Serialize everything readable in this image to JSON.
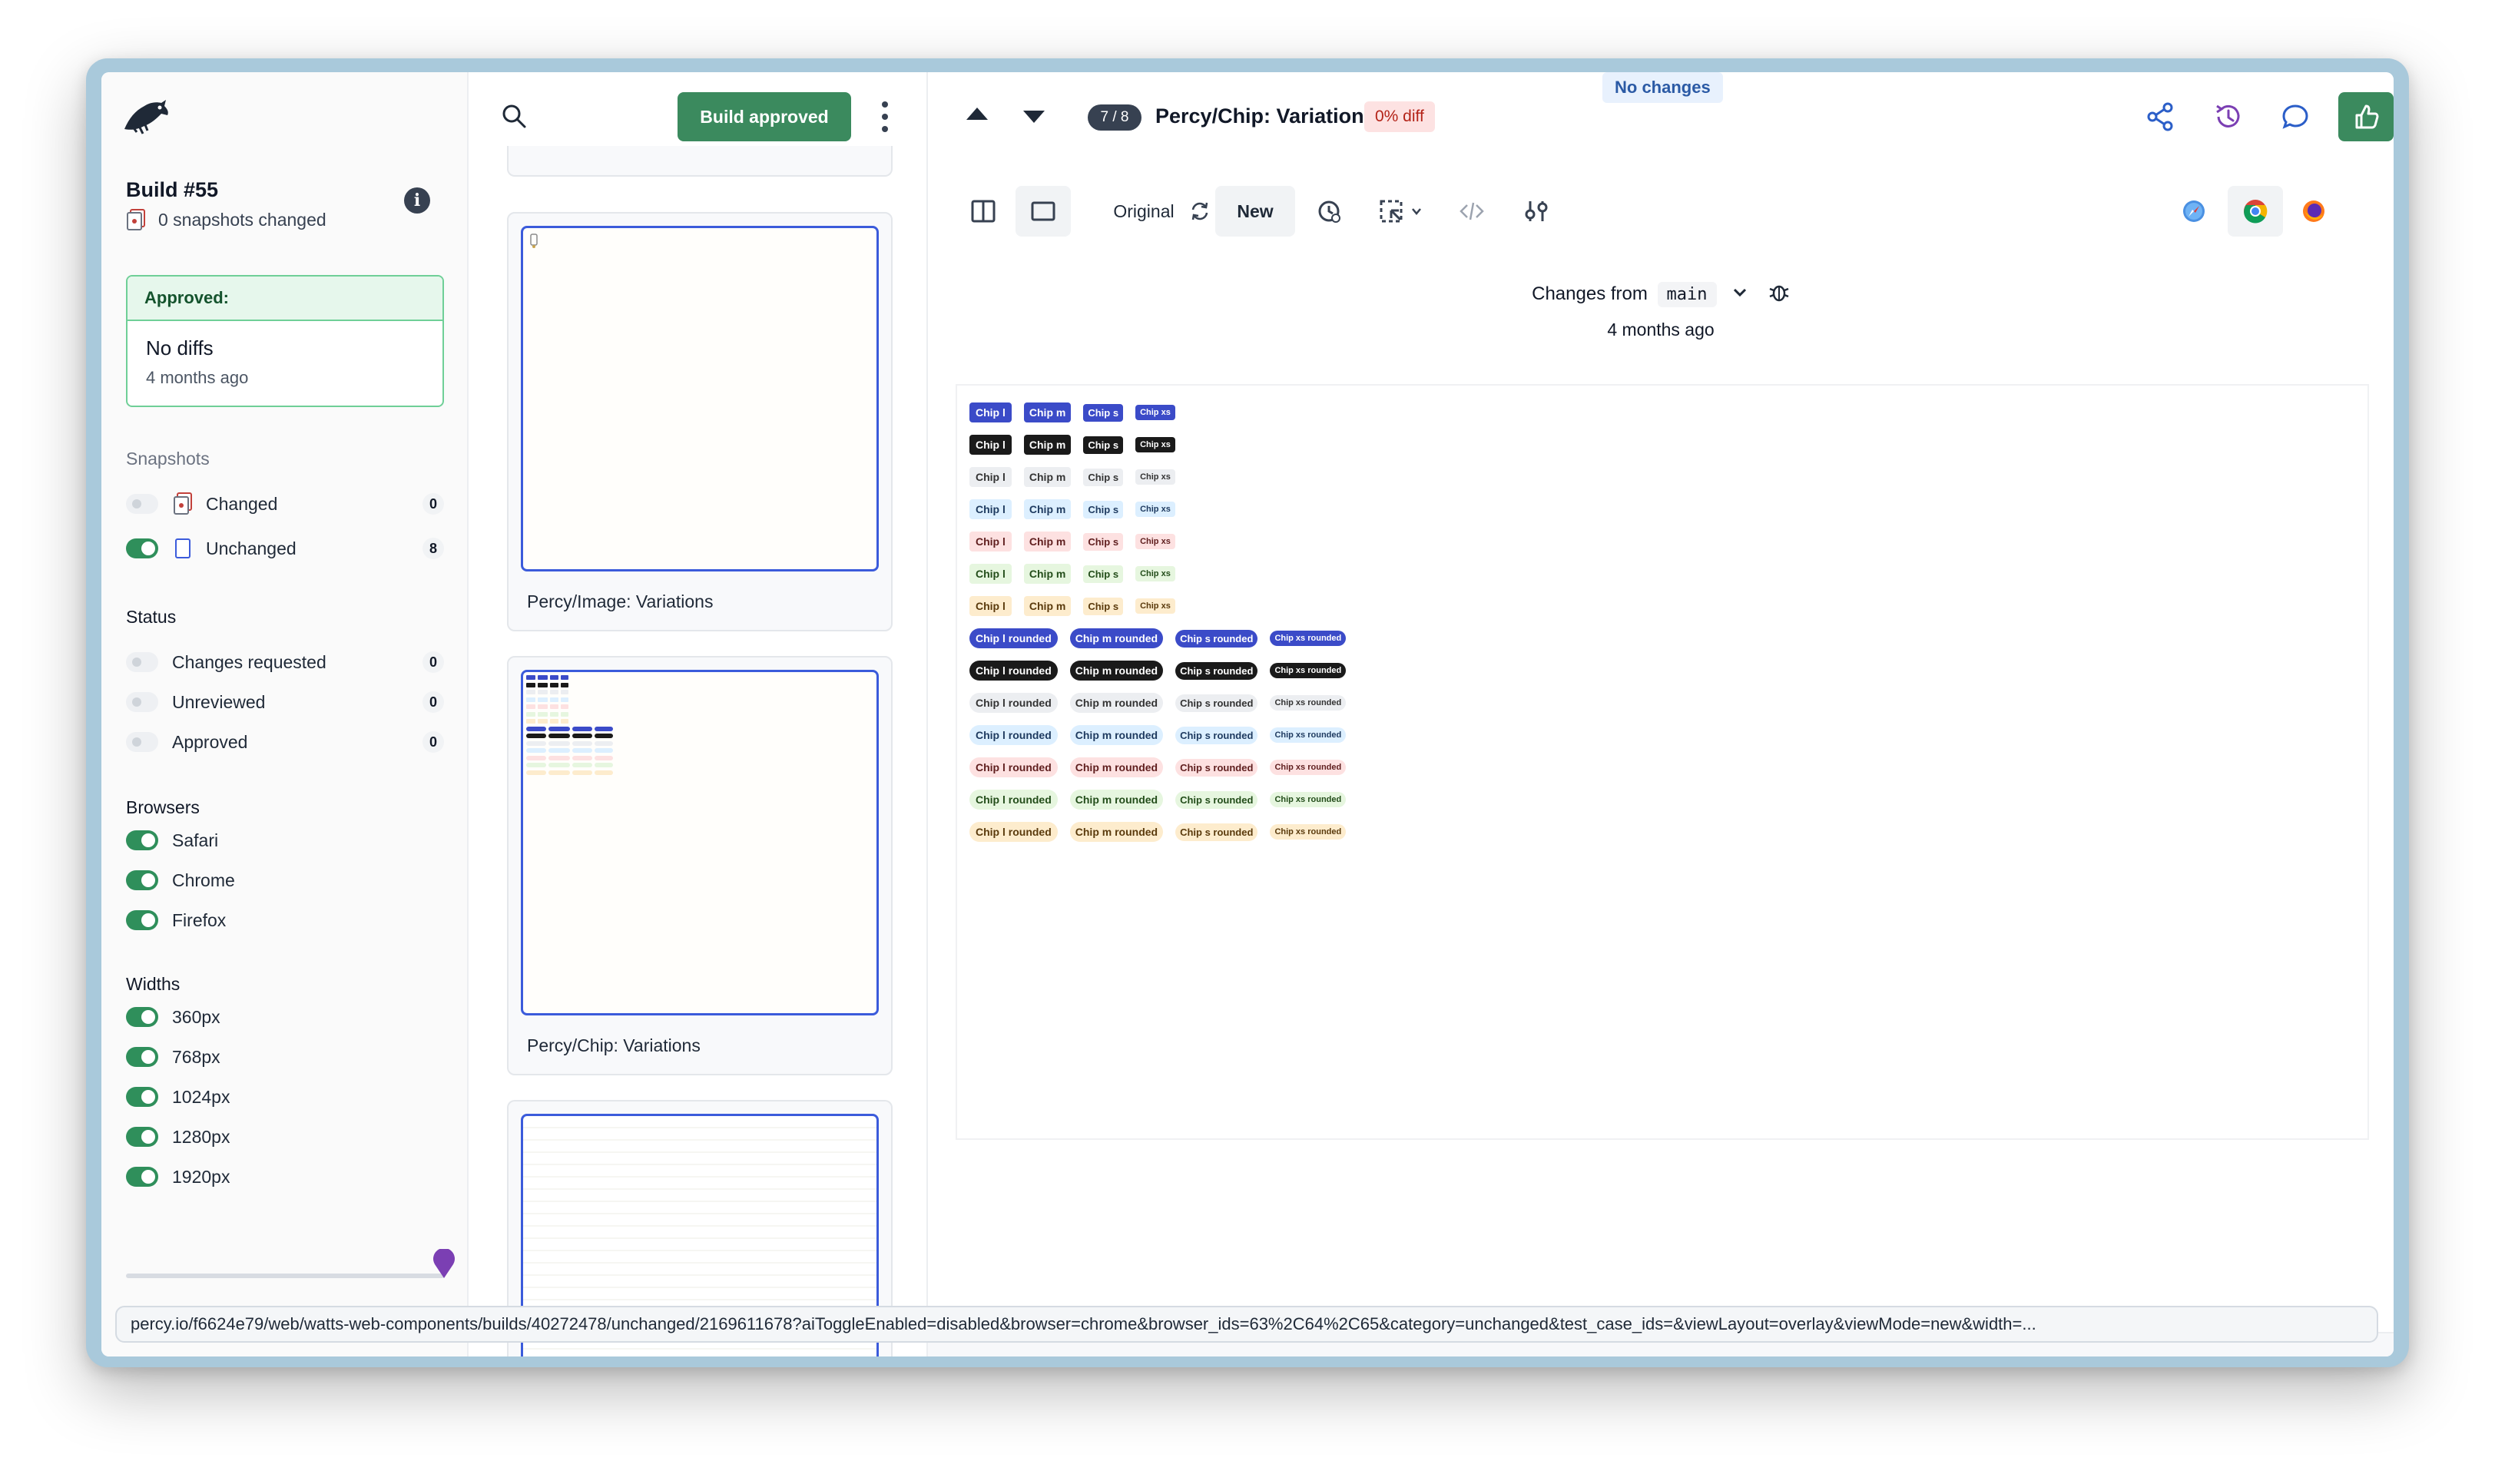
{
  "sidebar": {
    "build_title": "Build #55",
    "snapshots_changed": "0 snapshots changed",
    "approved_card": {
      "header": "Approved:",
      "status": "No diffs",
      "time": "4 months ago"
    },
    "snapshots_label": "Snapshots",
    "snapshot_filters": [
      {
        "label": "Changed",
        "count": "0",
        "enabled": false
      },
      {
        "label": "Unchanged",
        "count": "8",
        "enabled": true
      }
    ],
    "status_label": "Status",
    "status_filters": [
      {
        "label": "Changes requested",
        "count": "0"
      },
      {
        "label": "Unreviewed",
        "count": "0"
      },
      {
        "label": "Approved",
        "count": "0"
      }
    ],
    "browsers_label": "Browsers",
    "browsers": [
      {
        "label": "Safari",
        "enabled": true
      },
      {
        "label": "Chrome",
        "enabled": true
      },
      {
        "label": "Firefox",
        "enabled": true
      }
    ],
    "widths_label": "Widths",
    "widths": [
      {
        "label": "360px",
        "enabled": true
      },
      {
        "label": "768px",
        "enabled": true
      },
      {
        "label": "1024px",
        "enabled": true
      },
      {
        "label": "1280px",
        "enabled": true
      },
      {
        "label": "1920px",
        "enabled": true
      }
    ],
    "slider_value": 1.0
  },
  "list": {
    "build_approved_label": "Build approved",
    "cards": [
      {
        "label": "Percy/Image: Variations"
      },
      {
        "label": "Percy/Chip: Variations"
      }
    ]
  },
  "main": {
    "counter": "7 / 8",
    "snapshot_title": "Percy/Chip: Variations",
    "diff_badge": "0% diff",
    "no_changes_badge": "No changes",
    "toolbar": {
      "original_label": "Original",
      "new_label": "New"
    },
    "changes_from_label": "Changes from",
    "branch": "main",
    "changes_time": "4 months ago"
  },
  "chip_rows": [
    {
      "chips": [
        "Chip l",
        "Chip m",
        "Chip s",
        "Chip xs"
      ],
      "bg": "#3b4bc8",
      "fg": "#ffffff",
      "rounded": false
    },
    {
      "chips": [
        "Chip l",
        "Chip m",
        "Chip s",
        "Chip xs"
      ],
      "bg": "#1a1a1a",
      "fg": "#ffffff",
      "rounded": false
    },
    {
      "chips": [
        "Chip l",
        "Chip m",
        "Chip s",
        "Chip xs"
      ],
      "bg": "#eceef1",
      "fg": "#333333",
      "rounded": false
    },
    {
      "chips": [
        "Chip l",
        "Chip m",
        "Chip s",
        "Chip xs"
      ],
      "bg": "#dcefff",
      "fg": "#1e3a5f",
      "rounded": false
    },
    {
      "chips": [
        "Chip l",
        "Chip m",
        "Chip s",
        "Chip xs"
      ],
      "bg": "#fde1e1",
      "fg": "#5f1e1e",
      "rounded": false
    },
    {
      "chips": [
        "Chip l",
        "Chip m",
        "Chip s",
        "Chip xs"
      ],
      "bg": "#e6f6df",
      "fg": "#234d1a",
      "rounded": false
    },
    {
      "chips": [
        "Chip l",
        "Chip m",
        "Chip s",
        "Chip xs"
      ],
      "bg": "#fdeccd",
      "fg": "#5a3a0c",
      "rounded": false
    },
    {
      "chips": [
        "Chip l rounded",
        "Chip m rounded",
        "Chip s rounded",
        "Chip xs rounded"
      ],
      "bg": "#3b4bc8",
      "fg": "#ffffff",
      "rounded": true
    },
    {
      "chips": [
        "Chip l rounded",
        "Chip m rounded",
        "Chip s rounded",
        "Chip xs rounded"
      ],
      "bg": "#1a1a1a",
      "fg": "#ffffff",
      "rounded": true
    },
    {
      "chips": [
        "Chip l rounded",
        "Chip m rounded",
        "Chip s rounded",
        "Chip xs rounded"
      ],
      "bg": "#eceef1",
      "fg": "#333333",
      "rounded": true
    },
    {
      "chips": [
        "Chip l rounded",
        "Chip m rounded",
        "Chip s rounded",
        "Chip xs rounded"
      ],
      "bg": "#dcefff",
      "fg": "#1e3a5f",
      "rounded": true
    },
    {
      "chips": [
        "Chip l rounded",
        "Chip m rounded",
        "Chip s rounded",
        "Chip xs rounded"
      ],
      "bg": "#fde1e1",
      "fg": "#5f1e1e",
      "rounded": true
    },
    {
      "chips": [
        "Chip l rounded",
        "Chip m rounded",
        "Chip s rounded",
        "Chip xs rounded"
      ],
      "bg": "#e6f6df",
      "fg": "#234d1a",
      "rounded": true
    },
    {
      "chips": [
        "Chip l rounded",
        "Chip m rounded",
        "Chip s rounded",
        "Chip xs rounded"
      ],
      "bg": "#fdeccd",
      "fg": "#5a3a0c",
      "rounded": true
    }
  ],
  "status_bar_url": "percy.io/f6624e79/web/watts-web-components/builds/40272478/unchanged/2169611678?aiToggleEnabled=disabled&browser=chrome&browser_ids=63%2C64%2C65&category=unchanged&test_case_ids=&viewLayout=overlay&viewMode=new&width=...",
  "colors": {
    "accent_green": "#3b8a5e",
    "selection_blue": "#3b5bdb",
    "diff_red": "#b42318"
  },
  "icons": [
    "percy-logo-icon",
    "info-icon",
    "search-icon",
    "kebab-menu-icon",
    "chevron-up-icon",
    "chevron-down-icon",
    "share-icon",
    "history-icon",
    "comment-icon",
    "thumbs-up-icon",
    "split-view-icon",
    "single-view-icon",
    "swap-icon",
    "clock-icon",
    "region-select-icon",
    "code-icon",
    "settings-sliders-icon",
    "safari-icon",
    "chrome-icon",
    "firefox-icon",
    "bug-icon"
  ]
}
